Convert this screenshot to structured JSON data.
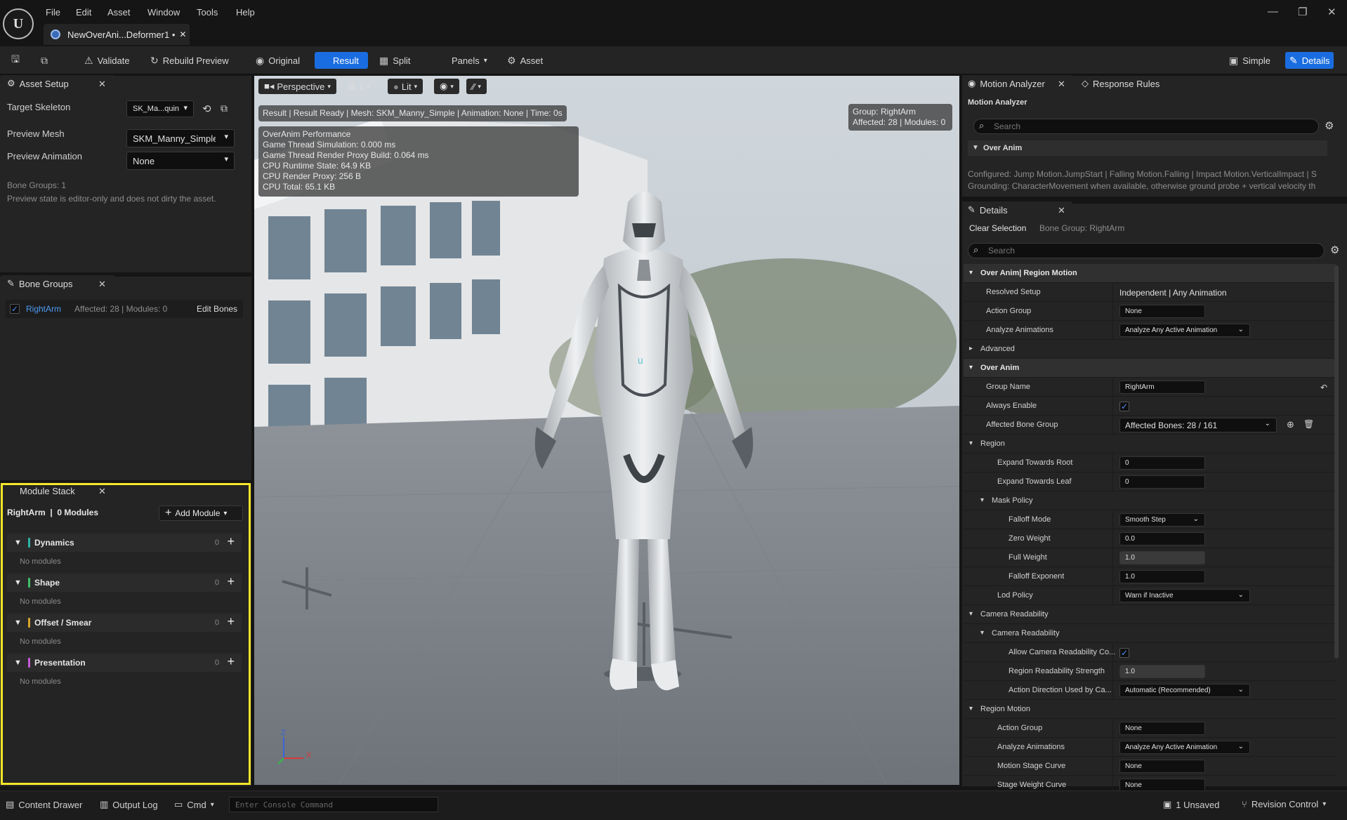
{
  "menu": [
    "File",
    "Edit",
    "Asset",
    "Window",
    "Tools",
    "Help"
  ],
  "document_tab": "NewOverAni...Deformer1 •",
  "toolbar": {
    "validate": "Validate",
    "rebuild": "Rebuild Preview",
    "original": "Original",
    "result": "Result",
    "split": "Split",
    "panels": "Panels",
    "asset": "Asset",
    "simple": "Simple",
    "details": "Details"
  },
  "asset_setup": {
    "tab": "Asset Setup",
    "target_skeleton_label": "Target Skeleton",
    "target_skeleton_value": "SK_Ma...quin",
    "preview_mesh_label": "Preview Mesh",
    "preview_mesh_value": "SKM_Manny_Simple",
    "preview_animation_label": "Preview Animation",
    "preview_animation_value": "None",
    "bone_groups_count": "Bone Groups: 1",
    "note": "Preview state is editor-only and does not dirty the asset."
  },
  "bone_groups": {
    "tab": "Bone Groups",
    "item_name": "RightArm",
    "item_info": "Affected: 28  |  Modules: 0",
    "edit_bones": "Edit Bones"
  },
  "module_stack": {
    "tab": "Module Stack",
    "title": "RightArm  |  0 Modules",
    "add_module": "Add Module",
    "empty_label": "No modules",
    "modules": [
      {
        "name": "Dynamics",
        "count": "0",
        "color": "#2bb3a6"
      },
      {
        "name": "Shape",
        "count": "0",
        "color": "#3fbf6b"
      },
      {
        "name": "Offset / Smear",
        "count": "0",
        "color": "#d6a62a"
      },
      {
        "name": "Presentation",
        "count": "0",
        "color": "#c45bd8"
      }
    ]
  },
  "viewport": {
    "perspective": "Perspective",
    "fov": "1",
    "lit": "Lit",
    "status_line": "Result | Result Ready | Mesh: SKM_Manny_Simple | Animation: None | Time: 0s",
    "perf_lines": [
      "OverAnim Performance",
      "Game Thread Simulation: 0.000 ms",
      "Game Thread Render Proxy Build: 0.064 ms",
      "CPU Runtime State: 64.9 KB",
      "CPU Render Proxy: 256 B",
      "CPU Total: 65.1 KB"
    ],
    "group_line1": "Group: RightArm",
    "group_line2": "Affected: 28 | Modules: 0",
    "axis_z": "Z",
    "axis_x": "X"
  },
  "motion_analyzer": {
    "tab": "Motion Analyzer",
    "tab2": "Response Rules",
    "title": "Motion Analyzer",
    "search_placeholder": "Search",
    "section": "Over Anim",
    "configured": "Configured: Jump Motion.JumpStart | Falling Motion.Falling | Impact Motion.VerticalImpact | S",
    "grounding": "Grounding: CharacterMovement when available, otherwise ground probe + vertical velocity th"
  },
  "details": {
    "tab": "Details",
    "clear_selection": "Clear Selection",
    "selection_label": "Bone Group: RightArm",
    "search_placeholder": "Search",
    "rows": [
      {
        "key": "Over Anim| Region Motion",
        "type": "section",
        "indent": 0,
        "expand": "▾"
      },
      {
        "key": "Resolved Setup",
        "type": "text",
        "value": "Independent | Any Animation",
        "indent": 1
      },
      {
        "key": "Action Group",
        "type": "box",
        "value": "None",
        "indent": 1
      },
      {
        "key": "Analyze Animations",
        "type": "dropdown",
        "value": "Analyze Any Active Animation",
        "indent": 1
      },
      {
        "key": "Advanced",
        "type": "group",
        "indent": 0,
        "expand": "▸"
      },
      {
        "key": "Over Anim",
        "type": "section",
        "indent": 0,
        "expand": "▾"
      },
      {
        "key": "Group Name",
        "type": "box",
        "value": "RightArm",
        "indent": 1,
        "reset": true
      },
      {
        "key": "Always Enable",
        "type": "check",
        "indent": 1
      },
      {
        "key": "Affected Bone Group",
        "type": "dropdown-wide",
        "value": "Affected Bones: 28 / 161",
        "indent": 1
      },
      {
        "key": "Region",
        "type": "group",
        "indent": 0,
        "expand": "▾"
      },
      {
        "key": "Expand Towards Root",
        "type": "box",
        "value": "0",
        "indent": 2
      },
      {
        "key": "Expand Towards Leaf",
        "type": "box",
        "value": "0",
        "indent": 2
      },
      {
        "key": "Mask Policy",
        "type": "group",
        "indent": 1,
        "expand": "▾"
      },
      {
        "key": "Falloff Mode",
        "type": "dropdown",
        "value": "Smooth Step",
        "indent": 3
      },
      {
        "key": "Zero Weight",
        "type": "box",
        "value": "0.0",
        "indent": 3
      },
      {
        "key": "Full Weight",
        "type": "box",
        "value": "1.0",
        "indent": 3,
        "fill": 1
      },
      {
        "key": "Falloff Exponent",
        "type": "box",
        "value": "1.0",
        "indent": 3
      },
      {
        "key": "Lod Policy",
        "type": "dropdown",
        "value": "Warn if Inactive",
        "indent": 2
      },
      {
        "key": "Camera Readability",
        "type": "group",
        "indent": 0,
        "expand": "▾"
      },
      {
        "key": "Camera Readability",
        "type": "group",
        "indent": 1,
        "expand": "▾"
      },
      {
        "key": "Allow Camera Readability Co...",
        "type": "check",
        "indent": 3
      },
      {
        "key": "Region Readability Strength",
        "type": "box",
        "value": "1.0",
        "indent": 3,
        "fill": 1
      },
      {
        "key": "Action Direction Used by Ca...",
        "type": "dropdown",
        "value": "Automatic (Recommended)",
        "indent": 3
      },
      {
        "key": "Region Motion",
        "type": "group",
        "indent": 0,
        "expand": "▾"
      },
      {
        "key": "Action Group",
        "type": "box",
        "value": "None",
        "indent": 2
      },
      {
        "key": "Analyze Animations",
        "type": "dropdown",
        "value": "Analyze Any Active Animation",
        "indent": 2
      },
      {
        "key": "Motion Stage Curve",
        "type": "box",
        "value": "None",
        "indent": 2
      },
      {
        "key": "Stage Weight Curve",
        "type": "box",
        "value": "None",
        "indent": 2
      }
    ]
  },
  "status": {
    "content_drawer": "Content Drawer",
    "output_log": "Output Log",
    "cmd": "Cmd",
    "console_placeholder": "Enter Console Command",
    "unsaved": "1 Unsaved",
    "revision": "Revision Control"
  },
  "colors": {
    "accent": "#1a6de0",
    "highlight": "#f5e62a"
  }
}
